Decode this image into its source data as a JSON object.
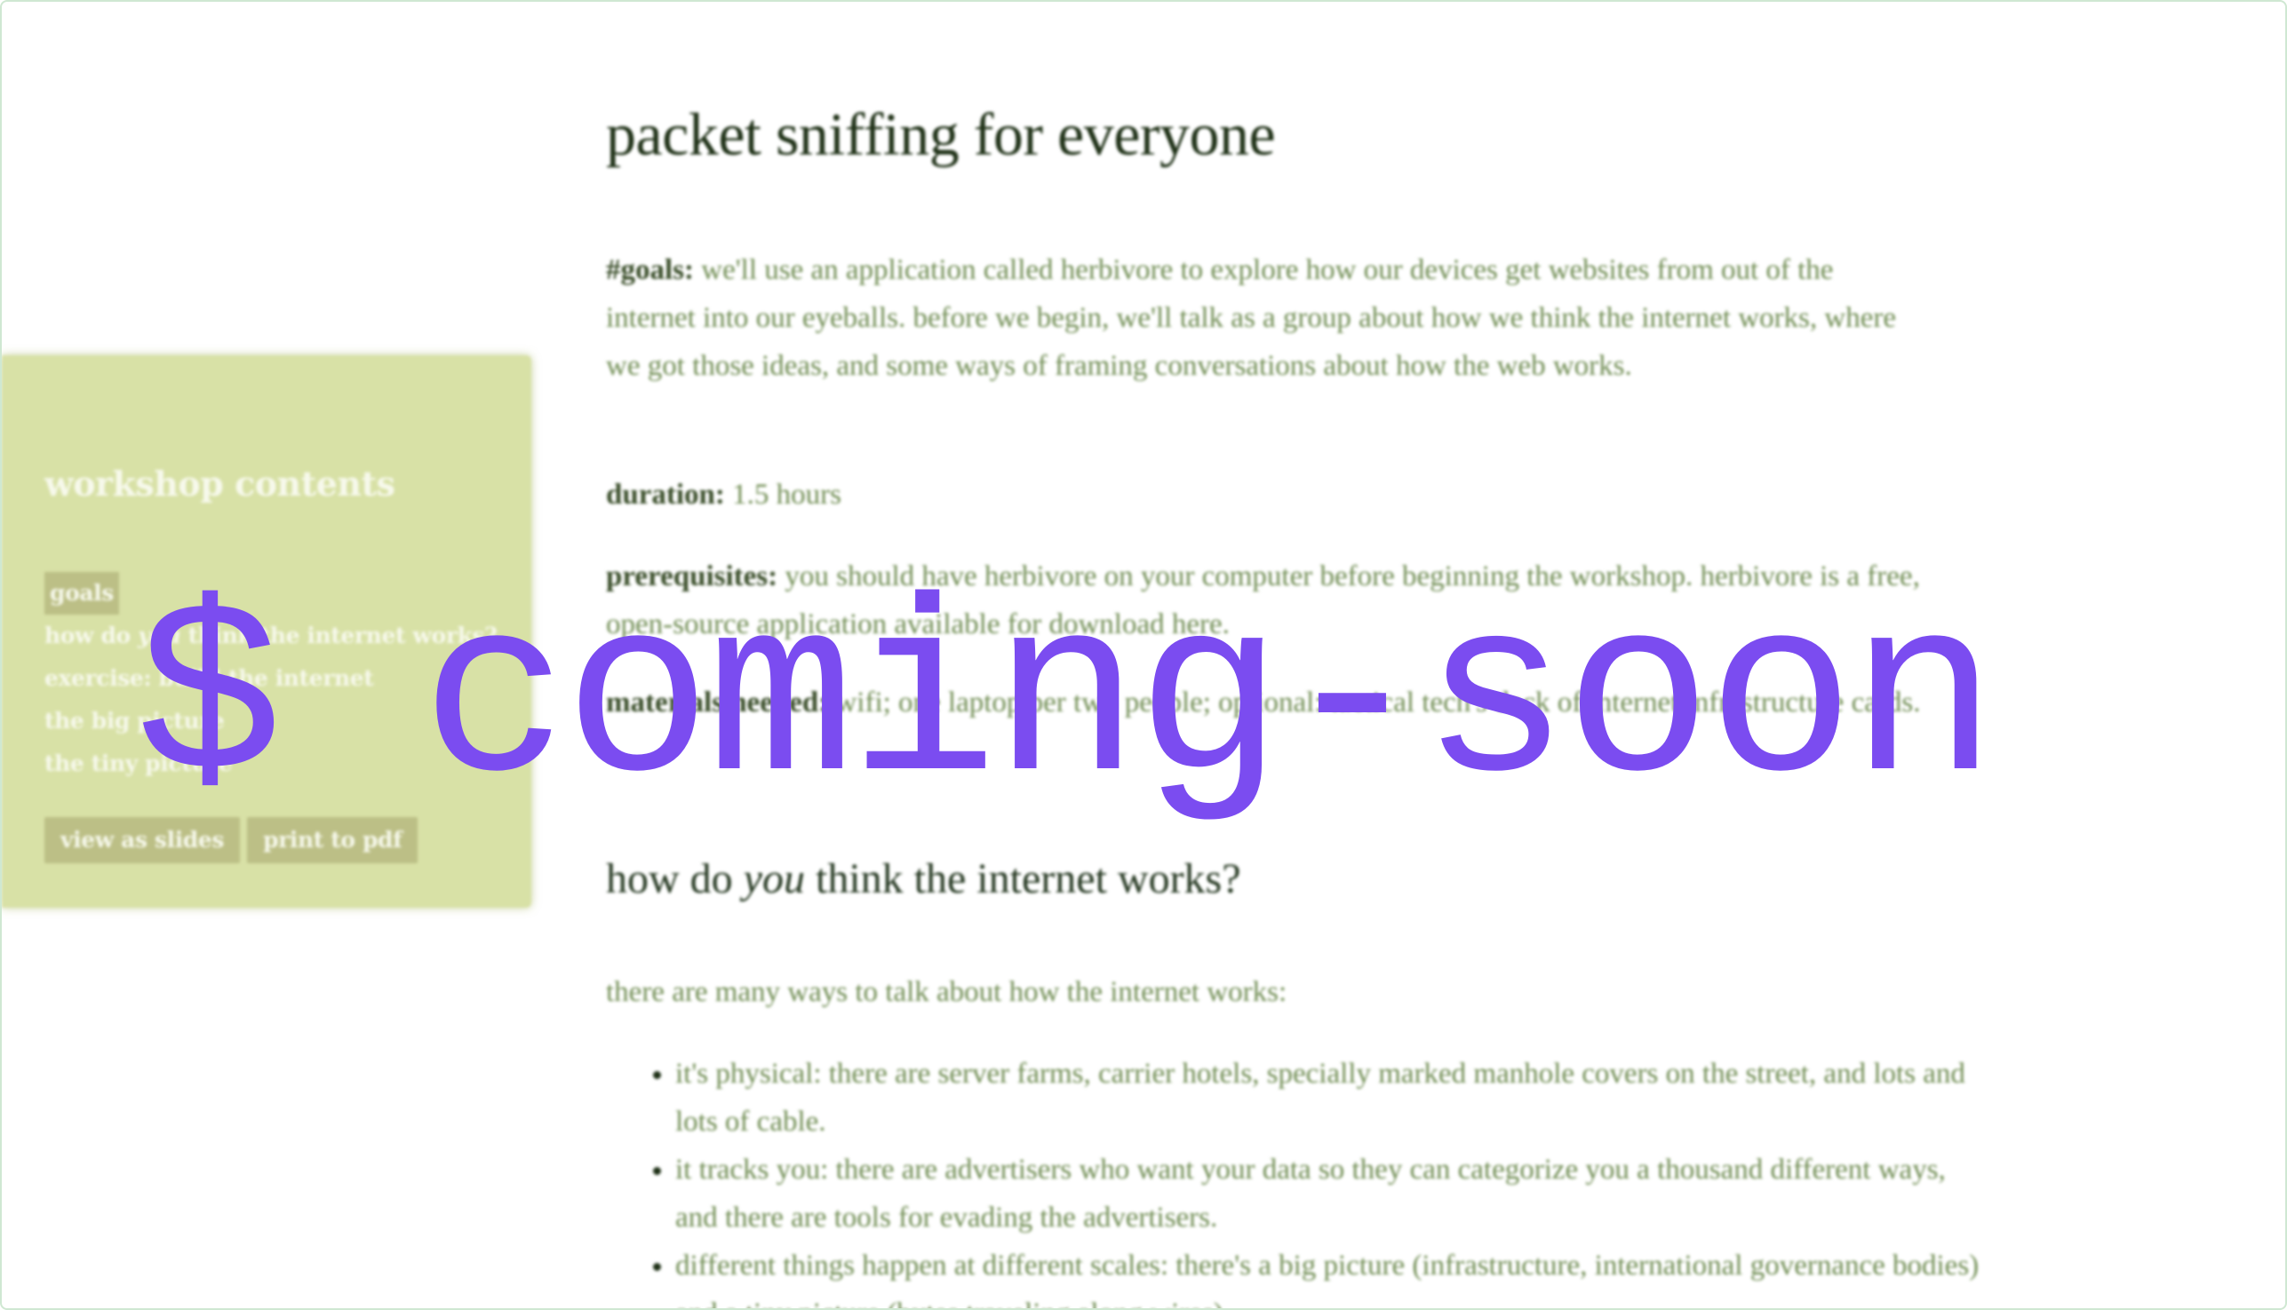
{
  "sidebar": {
    "title": "workshop contents",
    "items": [
      {
        "label": "goals",
        "active": true
      },
      {
        "label_before": "how do ",
        "label_em": "you",
        "label_after": " think the internet works?"
      },
      {
        "label": "exercise: build the internet"
      },
      {
        "label": "the big picture"
      },
      {
        "label": "the tiny picture"
      }
    ],
    "buttons": {
      "slides": "view as slides",
      "pdf": "print to pdf"
    }
  },
  "main": {
    "title": "packet sniffing for everyone",
    "goals": {
      "label": "#goals:",
      "text": "we'll use an application called herbivore to explore how our devices get websites from out of the internet into our eyeballs. before we begin, we'll talk as a group about how we think the internet works, where we got those ideas, and some ways of framing conversations about how the web works."
    },
    "duration": {
      "label": "duration:",
      "text": "1.5 hours"
    },
    "prerequisites": {
      "label": "prerequisites:",
      "text": "you should have herbivore on your computer before beginning the workshop. herbivore is a free, open-source application available for download here."
    },
    "materials": {
      "label": "materials needed:",
      "text": "wifi; one laptop per two people; optional: tactical tech's deck of internet infrastructure cards."
    },
    "section_heading": {
      "before": "how do ",
      "em": "you",
      "after": " think the internet works?"
    },
    "intro": "there are many ways to talk about how the internet works:",
    "bullets": [
      "it's physical: there are server farms, carrier hotels, specially marked manhole covers on the street, and lots and lots of cable.",
      "it tracks you: there are advertisers who want your data so they can categorize you a thousand different ways, and there are tools for evading the advertisers.",
      "different things happen at different scales: there's a big picture (infrastructure, international governance bodies) and a tiny picture (bytes traveling along wires)."
    ]
  },
  "overlay": {
    "text": "$ coming-soon",
    "color": "#7b4cf0"
  },
  "colors": {
    "sidebar_bg": "#d8e1a6",
    "body_text": "#6f8c52",
    "heading_text": "#1f3117"
  }
}
